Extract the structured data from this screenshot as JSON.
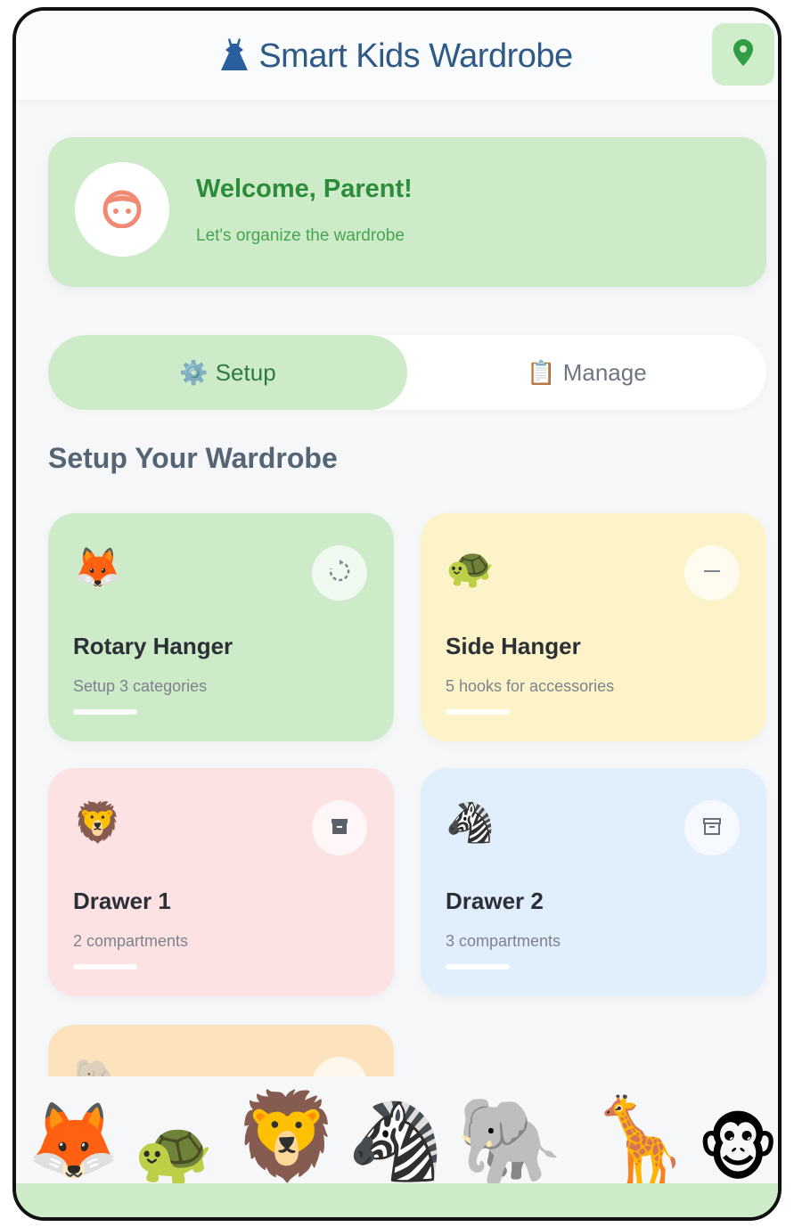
{
  "header": {
    "title": "Smart Kids Wardrobe",
    "title_icon": "dress-icon",
    "action_icon": "location-pin-icon"
  },
  "welcome": {
    "title": "Welcome, Parent!",
    "subtitle": "Let's organize the wardrobe",
    "avatar_icon": "child-face-icon"
  },
  "tabs": [
    {
      "label": "Setup",
      "icon": "⚙️",
      "active": true
    },
    {
      "label": "Manage",
      "icon": "📋",
      "active": false
    }
  ],
  "section_title": "Setup Your Wardrobe",
  "cards": [
    {
      "animal": "🦊",
      "title": "Rotary Hanger",
      "subtitle": "Setup 3 categories",
      "action_icon": "rotate-icon",
      "color": "#cdebc9"
    },
    {
      "animal": "🐢",
      "title": "Side Hanger",
      "subtitle": "5 hooks for accessories",
      "action_icon": "minus-icon",
      "color": "#fdf3c9"
    },
    {
      "animal": "🦁",
      "title": "Drawer 1",
      "subtitle": "2 compartments",
      "action_icon": "archive-box-icon",
      "color": "#fde2e3"
    },
    {
      "animal": "🦓",
      "title": "Drawer 2",
      "subtitle": "3 compartments",
      "action_icon": "archive-box-outline-icon",
      "color": "#e1effc"
    },
    {
      "animal": "🐘",
      "action_icon": "partial-icon",
      "color": "#fde3bd"
    }
  ],
  "animals_strip": [
    "🦊",
    "🐢",
    "🦁",
    "🦓",
    "🐘",
    "🦒",
    "🐵"
  ]
}
